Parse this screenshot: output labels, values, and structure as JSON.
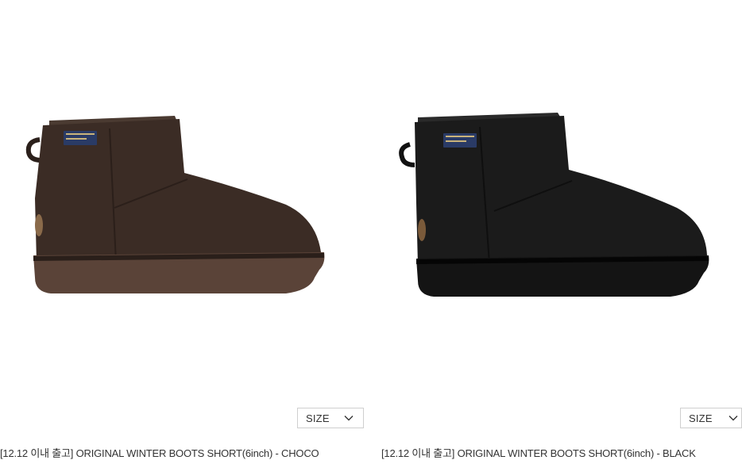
{
  "products": [
    {
      "name": "[12.12 이내 출고] ORIGINAL WINTER BOOTS SHORT(6inch) - CHOCO",
      "size_select": {
        "label": "SIZE",
        "icon": "chevron-down-icon"
      },
      "colors": {
        "upper": "#3b2c25",
        "sole": "#5a4338",
        "trim": "#2c201b"
      },
      "image_alt": "Choco winter boot"
    },
    {
      "name": "[12.12 이내 출고] ORIGINAL WINTER BOOTS SHORT(6inch) - BLACK",
      "size_select": {
        "label": "SIZE",
        "icon": "chevron-down-icon"
      },
      "colors": {
        "upper": "#1b1b1b",
        "sole": "#141414",
        "trim": "#111111"
      },
      "image_alt": "Black winter boot"
    }
  ]
}
